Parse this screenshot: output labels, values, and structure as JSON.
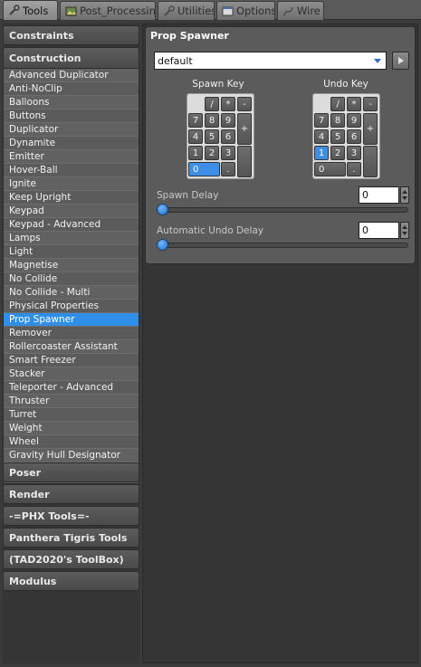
{
  "tabs": [
    {
      "label": "Tools",
      "icon": "wrench-icon",
      "active": true
    },
    {
      "label": "Post_Processing",
      "icon": "image-icon",
      "active": false
    },
    {
      "label": "Utilities",
      "icon": "wrench-icon",
      "active": false
    },
    {
      "label": "Options",
      "icon": "window-icon",
      "active": false
    },
    {
      "label": "Wire",
      "icon": "wire-icon",
      "active": false
    }
  ],
  "categories": {
    "constraints": "Constraints",
    "construction": "Construction",
    "poser": "Poser",
    "render": "Render",
    "phx": "-=PHX Tools=-",
    "panthera": "Panthera Tigris Tools",
    "tad": "(TAD2020's ToolBox)",
    "modulus": "Modulus"
  },
  "construction_tools": [
    "Advanced Duplicator",
    "Anti-NoClip",
    "Balloons",
    "Buttons",
    "Duplicator",
    "Dynamite",
    "Emitter",
    "Hover-Ball",
    "Ignite",
    "Keep Upright",
    "Keypad",
    "Keypad - Advanced",
    "Lamps",
    "Light",
    "Magnetise",
    "No Collide",
    "No Collide - Multi",
    "Physical Properties",
    "Prop Spawner",
    "Remover",
    "Rollercoaster Assistant",
    "Smart Freezer",
    "Stacker",
    "Teleporter - Advanced",
    "Thruster",
    "Turret",
    "Weight",
    "Wheel",
    "Gravity Hull Designator"
  ],
  "selected_tool": "Prop Spawner",
  "panel": {
    "title": "Prop Spawner",
    "preset_value": "default",
    "spawn_key_label": "Spawn Key",
    "undo_key_label": "Undo Key",
    "spawn_key_selected": "0",
    "undo_key_selected": "1",
    "keys": {
      "slash": "/",
      "star": "*",
      "minus": "-",
      "plus": "+",
      "k7": "7",
      "k8": "8",
      "k9": "9",
      "k4": "4",
      "k5": "5",
      "k6": "6",
      "k1": "1",
      "k2": "2",
      "k3": "3",
      "k0": "0",
      "dot": "."
    },
    "spawn_delay_label": "Spawn Delay",
    "spawn_delay_value": "0",
    "undo_delay_label": "Automatic Undo Delay",
    "undo_delay_value": "0"
  },
  "colors": {
    "selection": "#2f8ee8",
    "slider_thumb": "#3d8ee6"
  }
}
